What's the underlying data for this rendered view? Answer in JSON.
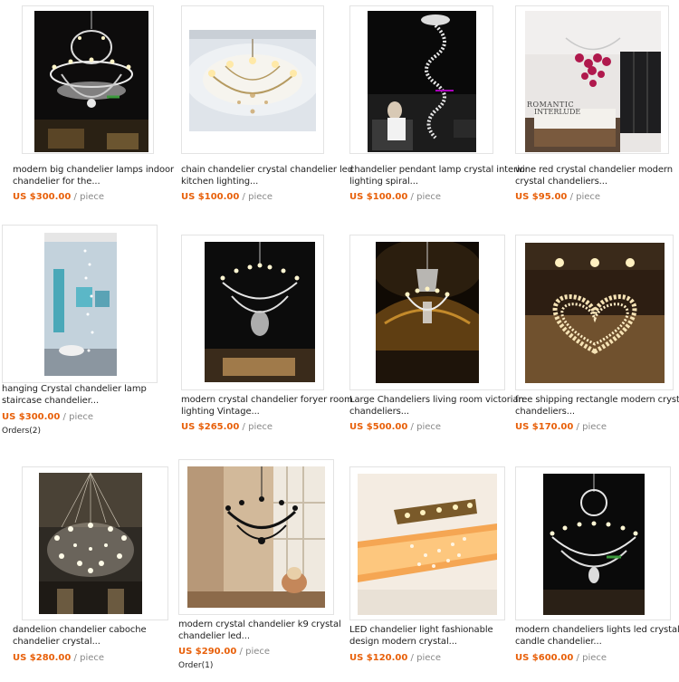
{
  "products": [
    {
      "id": "p1",
      "title_lines": [
        "modern big chandelier lamps indoor",
        "chandelier for the..."
      ],
      "price": "US $300.00",
      "unit": "/ piece"
    },
    {
      "id": "p2",
      "title_lines": [
        "chain chandelier crystal chandelier led",
        "kitchen lighting..."
      ],
      "price": "US $100.00",
      "unit": "/ piece"
    },
    {
      "id": "p3",
      "title_lines": [
        "chandelier pendant lamp crystal interior",
        "lighting spiral..."
      ],
      "price": "US $100.00",
      "unit": "/ piece"
    },
    {
      "id": "p4",
      "title_lines": [
        "wine red crystal chandelier modern",
        "crystal chandeliers..."
      ],
      "price": "US $95.00",
      "unit": "/ piece",
      "image_text": [
        "ROMANTIC",
        "INTERLUDE"
      ]
    },
    {
      "id": "p5",
      "title_lines": [
        "hanging Crystal chandelier lamp",
        "staircase chandelier..."
      ],
      "price": "US $300.00",
      "unit": "/ piece",
      "orders": "Orders(2)"
    },
    {
      "id": "p6",
      "title_lines": [
        "modern crystal chandelier foryer room",
        "lighting Vintage..."
      ],
      "price": "US $265.00",
      "unit": "/ piece"
    },
    {
      "id": "p7",
      "title_lines": [
        "Large Chandeliers living room victorian",
        "chandeliers..."
      ],
      "price": "US $500.00",
      "unit": "/ piece"
    },
    {
      "id": "p8",
      "title_lines": [
        "free shipping rectangle modern crystal",
        "chandeliers..."
      ],
      "price": "US $170.00",
      "unit": "/ piece"
    },
    {
      "id": "p9",
      "title_lines": [
        "dandelion chandelier caboche",
        "chandelier crystal..."
      ],
      "price": "US $280.00",
      "unit": "/ piece"
    },
    {
      "id": "p10",
      "title_lines": [
        "modern crystal chandelier k9 crystal",
        "chandelier led..."
      ],
      "price": "US $290.00",
      "unit": "/ piece",
      "orders": "Order(1)"
    },
    {
      "id": "p11",
      "title_lines": [
        "LED chandelier light fashionable",
        "design modern crystal..."
      ],
      "price": "US $120.00",
      "unit": "/ piece"
    },
    {
      "id": "p12",
      "title_lines": [
        "modern chandeliers lights led crystal",
        "candle chandelier..."
      ],
      "price": "US $600.00",
      "unit": "/ piece"
    }
  ],
  "colors": {
    "price": "#e8600a",
    "unit": "#888888",
    "title": "#222222",
    "card_border": "#e3e3e3"
  }
}
